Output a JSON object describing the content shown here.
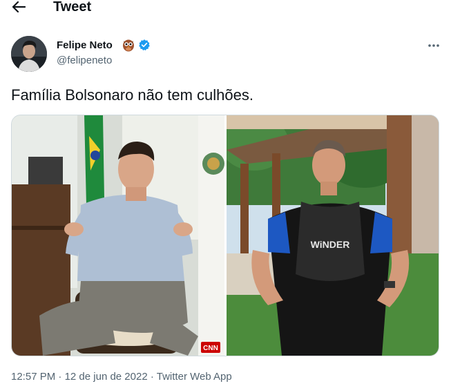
{
  "header": {
    "title": "Tweet",
    "back_icon": "arrow-left-icon"
  },
  "author": {
    "name": "Felipe Neto",
    "handle": "@felipeneto",
    "badge_emoji_icon": "owl-icon",
    "verified_icon": "verified-badge-icon",
    "more_icon": "more-horizontal-icon"
  },
  "tweet": {
    "text": "Família Bolsonaro não tem culhões."
  },
  "media": {
    "right_photo_suit_brand": "WiNDER",
    "left_photo_corner_logo": "CNN"
  },
  "meta": {
    "time": "12:57 PM",
    "separator": "·",
    "date": "12 de jun de 2022",
    "source": "Twitter Web App"
  },
  "colors": {
    "text_primary": "#0f1419",
    "text_secondary": "#536471",
    "verified_blue": "#1d9bf0",
    "border": "#cfd9de"
  }
}
